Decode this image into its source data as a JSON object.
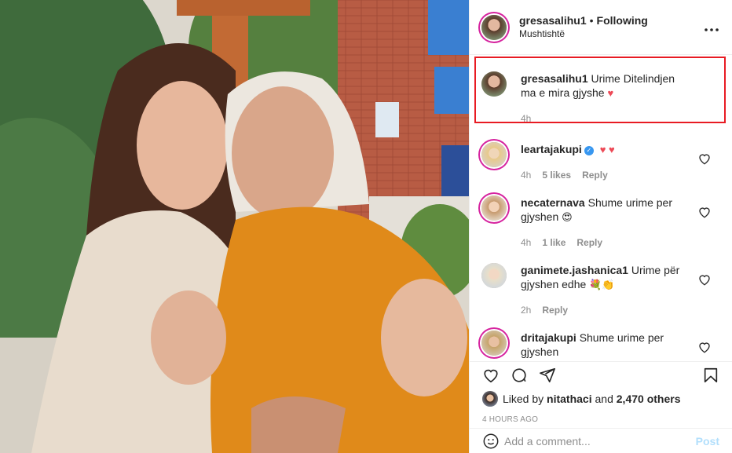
{
  "header": {
    "username": "gresasalihu1",
    "separator": "•",
    "follow_state": "Following",
    "location": "Mushtishtë"
  },
  "caption": {
    "username": "gresasalihu1",
    "text": "Urime Ditelindjen ma e mira gjyshe",
    "emoji": "♥",
    "time": "4h"
  },
  "comments": [
    {
      "username": "leartajakupi",
      "verified": true,
      "text": "",
      "emoji": "♥ ♥",
      "time": "4h",
      "likes": "5 likes",
      "reply": "Reply"
    },
    {
      "username": "necaternava",
      "verified": false,
      "text": "Shume urime per gjyshen",
      "emoji": "😍",
      "time": "4h",
      "likes": "1 like",
      "reply": "Reply"
    },
    {
      "username": "ganimete.jashanica1",
      "verified": false,
      "text": "Urime për gjyshen edhe",
      "emoji": "💐👏",
      "time": "2h",
      "likes": "",
      "reply": "Reply"
    },
    {
      "username": "dritajakupi",
      "verified": false,
      "text": "Shume urime per gjyshen",
      "emoji": "",
      "time": "",
      "likes": "",
      "reply": ""
    }
  ],
  "actions": {
    "liked_prefix": "Liked by",
    "liked_user": "nitathaci",
    "liked_mid": "and",
    "liked_count": "2,470 others",
    "timestamp": "4 HOURS AGO"
  },
  "add_comment": {
    "placeholder": "Add a comment...",
    "post_label": "Post"
  },
  "colors": {
    "highlight": "#e81b23",
    "link": "#3897f0",
    "muted": "#8e8e8e",
    "post_disabled": "#b2dffc"
  },
  "icons": [
    "more-options-icon",
    "heart-icon",
    "comment-icon",
    "share-icon",
    "bookmark-icon",
    "emoji-icon",
    "verified-icon"
  ]
}
